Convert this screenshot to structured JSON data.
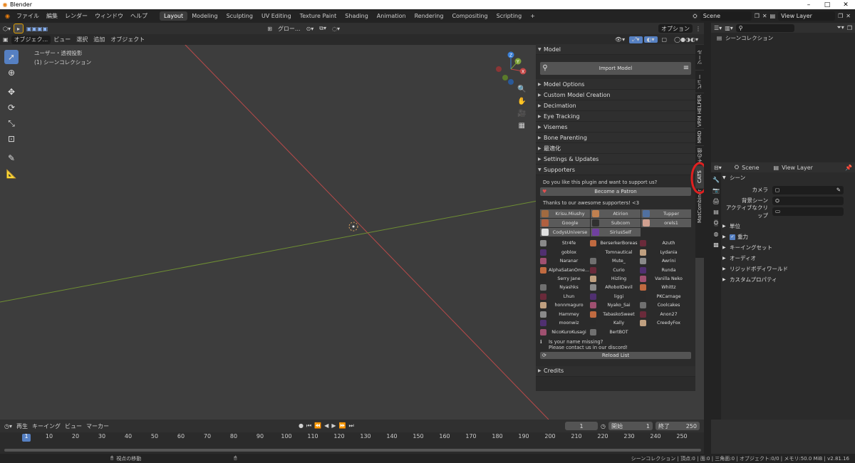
{
  "window": {
    "title": "Blender",
    "min": "–",
    "max": "□",
    "close": "✕"
  },
  "menu": {
    "items": [
      "ファイル",
      "編集",
      "レンダー",
      "ウィンドウ",
      "ヘルプ"
    ],
    "workspaces": [
      "Layout",
      "Modeling",
      "Sculpting",
      "UV Editing",
      "Texture Paint",
      "Shading",
      "Animation",
      "Rendering",
      "Compositing",
      "Scripting"
    ],
    "add_workspace": "+",
    "scene": "Scene",
    "view_layer": "View Layer"
  },
  "viewport": {
    "header": {
      "mode": "オブジェク...",
      "view": "ビュー",
      "select": "選択",
      "add": "追加",
      "object": "オブジェクト",
      "orientation": "グロー...",
      "options": "オプション"
    },
    "overlay_text": {
      "line1": "ユーザー・透視投影",
      "line2": "(1) シーンコレクション"
    },
    "tools": [
      "select-tool",
      "cursor-tool",
      "move-tool",
      "rotate-tool",
      "scale-tool",
      "transform-tool",
      "annotate-tool",
      "measure-tool"
    ]
  },
  "npanel": {
    "model_header": "Model",
    "import_button": "Import Model",
    "sections": [
      "Model Options",
      "Custom Model Creation",
      "Decimation",
      "Eye Tracking",
      "Visemes",
      "Bone Parenting",
      "最適化",
      "Settings & Updates"
    ],
    "supporters_header": "Supporters",
    "support_question": "Do you like this plugin and want to support us?",
    "patron_button": "Become a Patron",
    "thanks": "Thanks to our awesome supporters! <3",
    "top_supporters": [
      "Krisu.Miushy",
      "Atirion",
      "Tupper",
      "Google",
      "Subcom",
      "orels1",
      "CodysUniverse",
      "SiriusSelf"
    ],
    "supporters": [
      "Str4fe",
      "BerserkerBoreas",
      "Azuth",
      "goblox",
      "Tomnautical",
      "Lydania",
      "Naranar",
      "Mute_",
      "Awrini",
      "AlphaSatanOme...",
      "Curio",
      "Runda",
      "Serry Jane",
      "Hizling",
      "Vanilla Neko",
      "Nyashks",
      "ARobotDevil",
      "Whittz",
      "Lhun",
      "liggi",
      "PKCarnage",
      "honnmaguro",
      "Nyako_Sai",
      "Coolcakes",
      "Hammey",
      "TabaskoSweet",
      "Anon27",
      "moonwiz",
      "Kally",
      "CreedyFox",
      "NicoKuroKusagi",
      "BertBOT"
    ],
    "missing_line1": "Is your name missing?",
    "missing_line2": "Please contact us in our discord!",
    "reload_button": "Reload List",
    "credits": "Credits"
  },
  "vtabs": [
    "ツール",
    "ビュー",
    "VRM HELPER",
    "MMD",
    "その他",
    "CATS",
    "MatCombiner"
  ],
  "outliner": {
    "title": "シーンコレクション"
  },
  "properties": {
    "scene": "Scene",
    "view_layer": "View Layer",
    "section_scene": "シーン",
    "camera_label": "カメラ",
    "bg_scene_label": "背景シーン",
    "active_clip_label": "アクティブなクリップ",
    "subsections": [
      "単位",
      "重力",
      "キーイングセット",
      "オーディオ",
      "リジッドボディワールド",
      "カスタムプロパティ"
    ]
  },
  "timeline": {
    "playback": "再生",
    "keying": "キーイング",
    "view": "ビュー",
    "marker": "マーカー",
    "current_frame": "1",
    "start_label": "開始",
    "start": "1",
    "end_label": "終了",
    "end": "250",
    "ticks": [
      "1",
      "10",
      "20",
      "30",
      "40",
      "50",
      "60",
      "70",
      "80",
      "90",
      "100",
      "110",
      "120",
      "130",
      "140",
      "150",
      "160",
      "170",
      "180",
      "190",
      "200",
      "210",
      "220",
      "230",
      "240",
      "250"
    ]
  },
  "status": {
    "hint": "視点の移動",
    "stats": "シーンコレクション | 頂点:0 | 面:0 | 三角面:0 | オブジェクト:0/0 | メモリ:50.0 MiB | v2.81.16"
  },
  "colors": {
    "accent": "#5680c2",
    "highlight": "#e02020",
    "x_axis": "#c44747",
    "y_axis": "#7fa33a",
    "z_axis": "#3a7fd6"
  }
}
